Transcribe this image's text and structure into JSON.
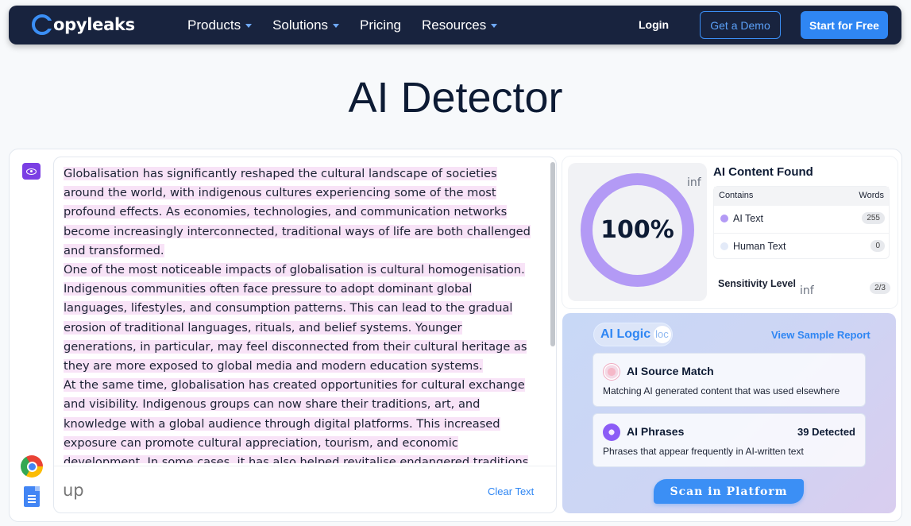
{
  "nav": {
    "logo_text": "opyleaks",
    "links": [
      {
        "label": "Products",
        "dropdown": true
      },
      {
        "label": "Solutions",
        "dropdown": true
      },
      {
        "label": "Pricing",
        "dropdown": false
      },
      {
        "label": "Resources",
        "dropdown": true
      }
    ],
    "login": "Login",
    "demo": "Get a Demo",
    "start": "Start for Free"
  },
  "page_title": "AI Detector",
  "editor": {
    "paragraphs": [
      "Globalisation has significantly reshaped the cultural landscape of societies around the world, with indigenous cultures experiencing some of the most profound effects. As economies, technologies, and communication networks become increasingly interconnected, traditional ways of life are both challenged and transformed.",
      "One of the most noticeable impacts of globalisation is cultural homogenisation. Indigenous communities often face pressure to adopt dominant global languages, lifestyles, and consumption patterns. This can lead to the gradual erosion of traditional languages, rituals, and belief systems. Younger generations, in particular, may feel disconnected from their cultural heritage as they are more exposed to global media and modern education systems.",
      "At the same time, globalisation has created opportunities for cultural exchange and visibility. Indigenous groups can now share their traditions, art, and knowledge with a global audience through digital platforms. This increased exposure can promote cultural appreciation, tourism, and economic development. In some cases, it has also helped revitalise endangered traditions by sparking renewed interest within"
    ],
    "upload_placeholder": "up",
    "clear_label": "Clear Text"
  },
  "results": {
    "percent": "100%",
    "percent_value": 100,
    "gauge_info": "inf",
    "title": "AI Content Found",
    "col_contains": "Contains",
    "col_words": "Words",
    "rows": [
      {
        "label": "AI Text",
        "count": "255",
        "color": "#b39af5"
      },
      {
        "label": "Human Text",
        "count": "0",
        "color": "#e3eaf8"
      }
    ],
    "sensitivity_label": "Sensitivity Level",
    "sensitivity_info": "inf",
    "sensitivity_value": "2/3"
  },
  "logic": {
    "pill_label": "AI Logic",
    "pill_placeholder": "loc",
    "sample_link": "View Sample Report",
    "features": [
      {
        "title": "AI Source Match",
        "count": "",
        "desc": "Matching AI generated content that was used elsewhere"
      },
      {
        "title": "AI Phrases",
        "count": "39 Detected",
        "desc": "Phrases that appear frequently in AI-written text"
      }
    ],
    "scan_label": "Scan in Platform"
  },
  "colors": {
    "nav_bg": "#18233e",
    "accent": "#2f86f3",
    "gauge": "#b39af5",
    "highlight": "#f8e3f7"
  }
}
